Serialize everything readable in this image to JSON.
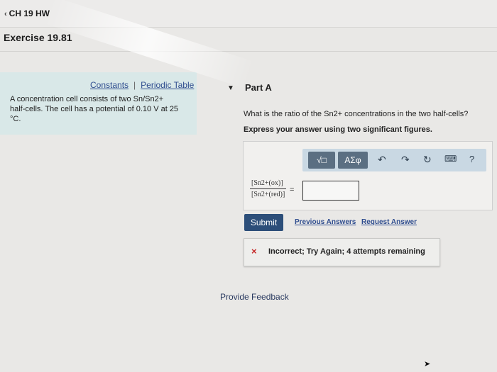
{
  "header": {
    "back_label": "CH 19 HW",
    "exercise_title": "Exercise 19.81"
  },
  "sidebar": {
    "links": [
      {
        "label": "Constants"
      },
      {
        "label": "Periodic Table"
      }
    ],
    "link_separator": "|",
    "description_line1": "A concentration cell consists of two Sn/Sn2+",
    "description_line2": "half-cells. The cell has a potential of 0.10 V at 25",
    "description_line3": "°C."
  },
  "part": {
    "label": "Part A",
    "question": "What is the ratio of the Sn2+ concentrations in the two half-cells?",
    "instruction": "Express your answer using two significant figures."
  },
  "toolbar": {
    "template_button": "√□",
    "greek_button": "ΑΣφ",
    "undo_icon": "undo-icon",
    "redo_icon": "redo-icon",
    "reset_icon": "reset-icon",
    "keyboard_icon": "keyboard-icon",
    "help_label": "?"
  },
  "answer": {
    "numerator": "[Sn2+(ox)]",
    "denominator": "[Sn2+(red)]",
    "equals": "=",
    "value": ""
  },
  "actions": {
    "submit": "Submit",
    "previous_answers": "Previous Answers",
    "request_answer": "Request Answer"
  },
  "feedback": {
    "icon": "×",
    "message": "Incorrect; Try Again; 4 attempts remaining"
  },
  "footer": {
    "provide_feedback": "Provide Feedback"
  },
  "colors": {
    "accent": "#2c4e79",
    "sidebar_bg": "#d9e8e8",
    "error": "#c62828",
    "toolbar_bg": "#c9d8e3"
  }
}
